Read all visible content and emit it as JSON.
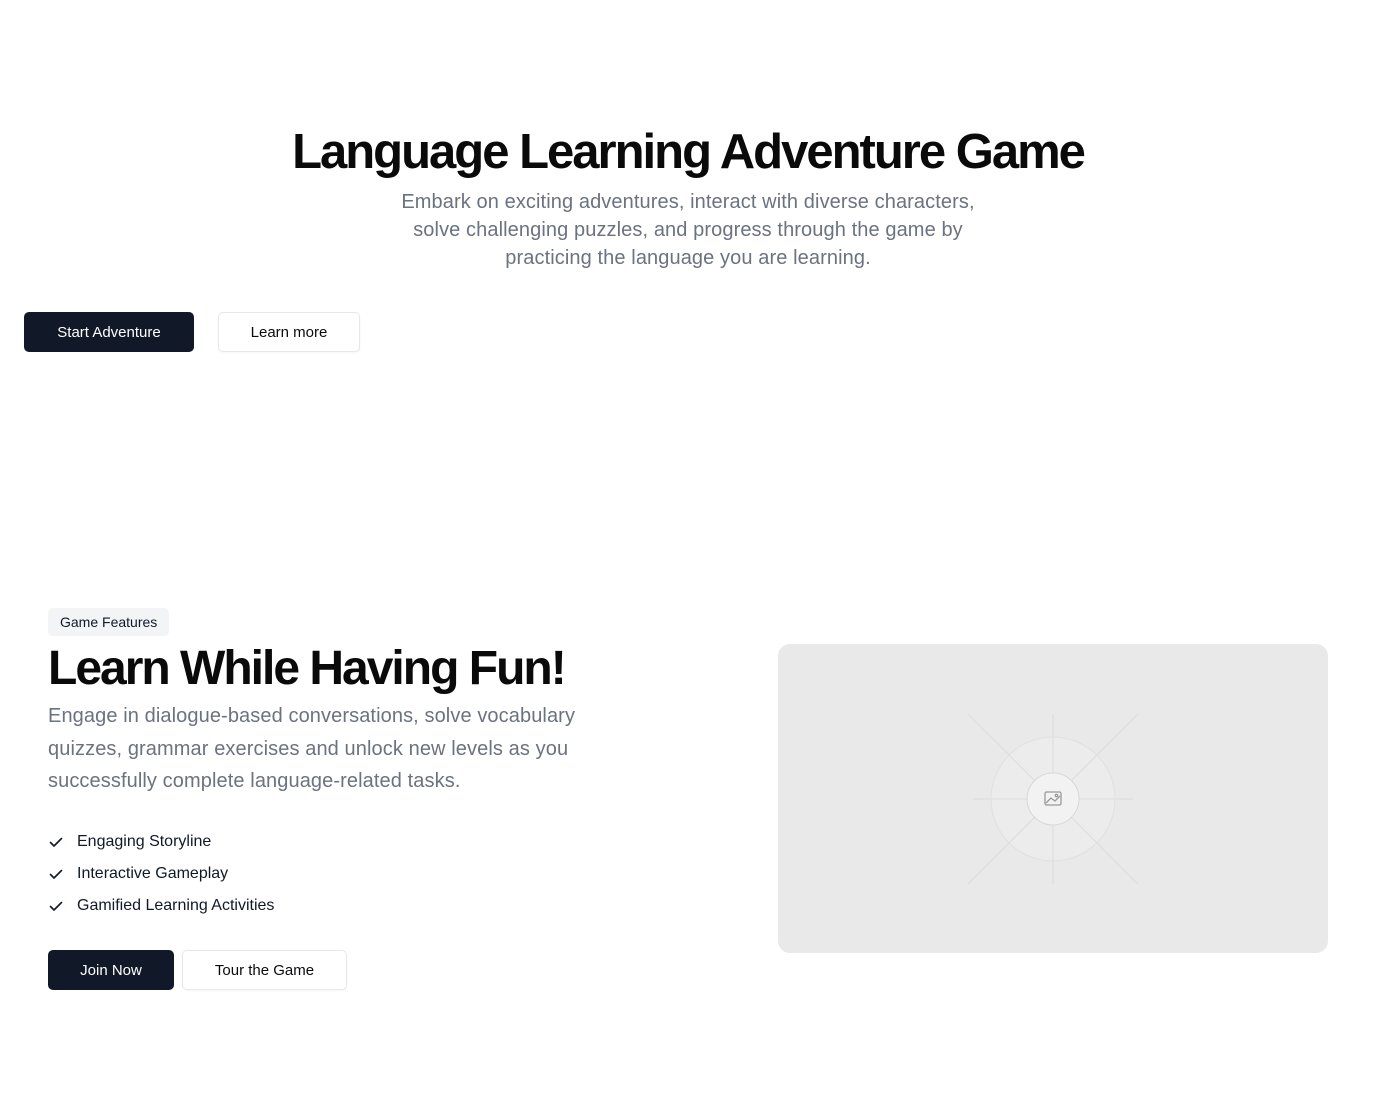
{
  "hero": {
    "title": "Language Learning Adventure Game",
    "subtitle": "Embark on exciting adventures, interact with diverse characters, solve challenging puzzles, and progress through the game by practicing the language you are learning.",
    "primary_button": "Start Adventure",
    "secondary_button": "Learn more"
  },
  "features": {
    "badge": "Game Features",
    "title": "Learn While Having Fun!",
    "subtitle": "Engage in dialogue-based conversations, solve vocabulary quizzes, grammar exercises and unlock new levels as you successfully complete language-related tasks.",
    "items": [
      {
        "label": "Engaging Storyline",
        "icon": "check-icon"
      },
      {
        "label": "Interactive Gameplay",
        "icon": "check-icon"
      },
      {
        "label": "Gamified Learning Activities",
        "icon": "check-icon"
      }
    ],
    "primary_button": "Join Now",
    "secondary_button": "Tour the Game",
    "image_icon": "image-placeholder-icon"
  },
  "colors": {
    "primary_button_bg": "#111827",
    "muted_text": "#6b7280",
    "badge_bg": "#f3f4f6",
    "placeholder_bg": "#e9e9e9"
  }
}
